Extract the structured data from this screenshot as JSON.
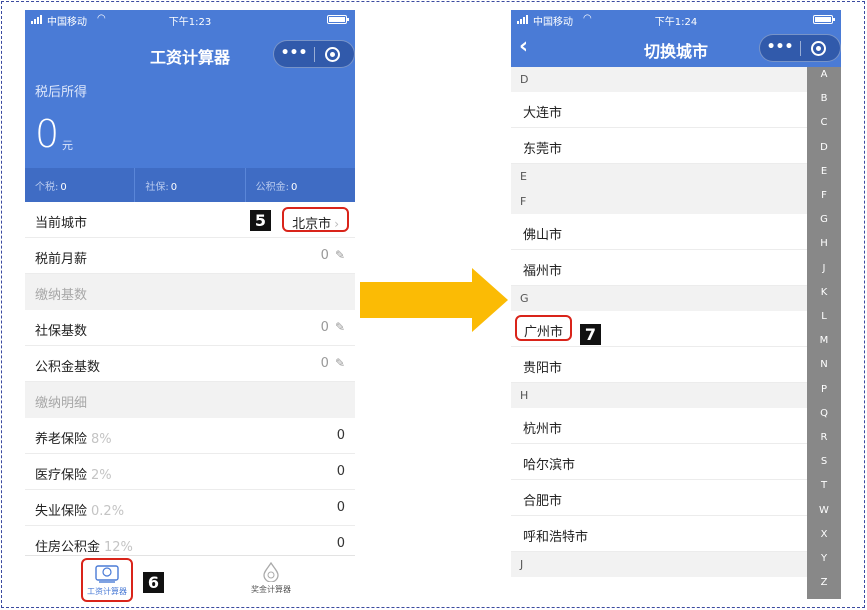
{
  "left": {
    "status": {
      "carrier": "中国移动",
      "time": "下午1:23"
    },
    "title": "工资计算器",
    "income": {
      "label": "税后所得",
      "value": "0",
      "unit": "元"
    },
    "taxes": [
      {
        "label": "个税:",
        "value": "0"
      },
      {
        "label": "社保:",
        "value": "0"
      },
      {
        "label": "公积金:",
        "value": "0"
      }
    ],
    "rows": {
      "city_label": "当前城市",
      "city_value": "北京市",
      "salary_label": "税前月薪",
      "salary_value": "0",
      "base_section": "缴纳基数",
      "social_base_label": "社保基数",
      "social_base_value": "0",
      "fund_base_label": "公积金基数",
      "fund_base_value": "0",
      "detail_section": "缴纳明细"
    },
    "details": [
      {
        "label": "养老保险",
        "rate": "8%",
        "value": "0"
      },
      {
        "label": "医疗保险",
        "rate": "2%",
        "value": "0"
      },
      {
        "label": "失业保险",
        "rate": "0.2%",
        "value": "0"
      },
      {
        "label": "住房公积金",
        "rate": "12%",
        "value": "0"
      }
    ],
    "tabs": {
      "salary": "工资计算器",
      "bonus": "奖金计算器"
    }
  },
  "right": {
    "status": {
      "carrier": "中国移动",
      "time": "下午1:24"
    },
    "title": "切换城市",
    "back_glyph": "‹",
    "sections": [
      {
        "letter": "D",
        "cities": [
          "大连市",
          "东莞市"
        ]
      },
      {
        "letter": "E",
        "cities": []
      },
      {
        "letter": "F",
        "cities": [
          "佛山市",
          "福州市"
        ]
      },
      {
        "letter": "G",
        "cities": [
          "广州市",
          "贵阳市"
        ]
      },
      {
        "letter": "H",
        "cities": [
          "杭州市",
          "哈尔滨市",
          "合肥市",
          "呼和浩特市"
        ]
      },
      {
        "letter": "J",
        "cities": []
      }
    ],
    "index_letters": [
      "A",
      "B",
      "C",
      "D",
      "E",
      "F",
      "G",
      "H",
      "J",
      "K",
      "L",
      "M",
      "N",
      "P",
      "Q",
      "R",
      "S",
      "T",
      "W",
      "X",
      "Y",
      "Z"
    ]
  },
  "badges": {
    "step5": "5",
    "step6": "6",
    "step7": "7"
  },
  "colors": {
    "brand": "#4a7bd6",
    "highlight": "#d9241a",
    "arrow": "#fbbb05"
  },
  "icons": {
    "more": "•••",
    "pencil": "✎",
    "chevron": "›"
  }
}
